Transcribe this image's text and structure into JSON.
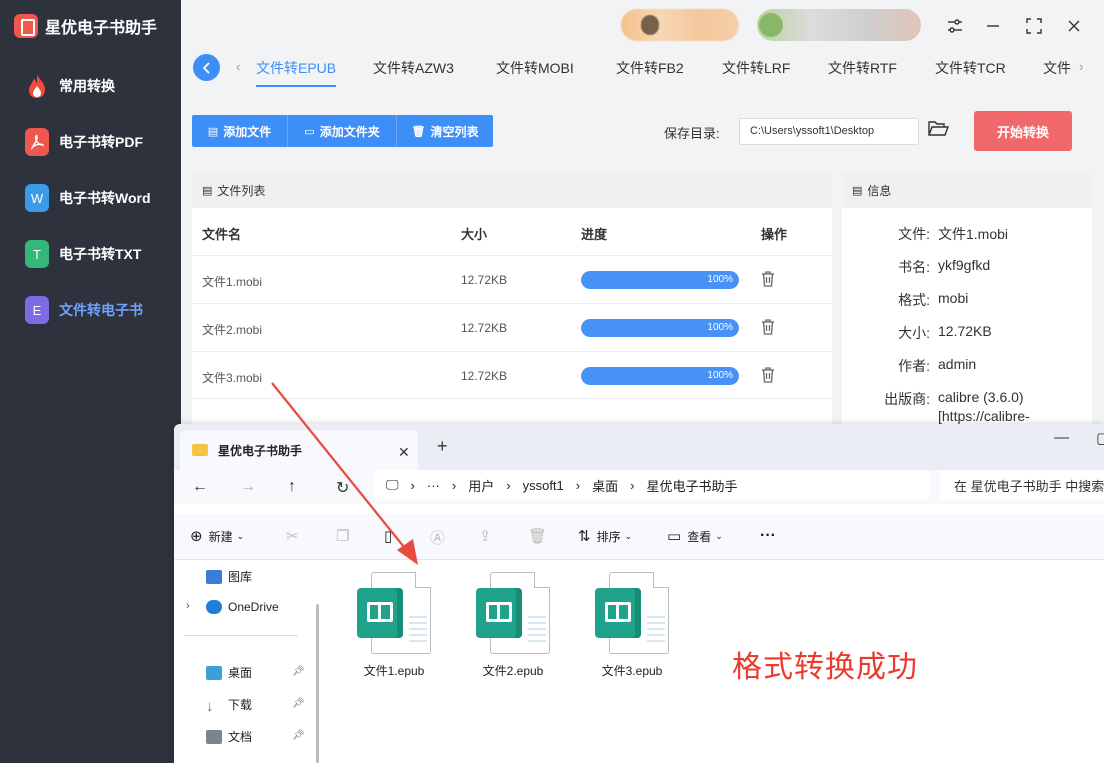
{
  "app": {
    "title": "星优电子书助手",
    "window_controls": [
      "settings-icon",
      "minimize-icon",
      "maximize-icon",
      "close-icon"
    ]
  },
  "sidebar": {
    "items": [
      {
        "label": "常用转换",
        "icon": "fire-icon",
        "color": "#f15a3a",
        "active": false
      },
      {
        "label": "电子书转PDF",
        "icon": "pdf-icon",
        "color": "#f0574f",
        "active": false
      },
      {
        "label": "电子书转Word",
        "icon": "word-icon",
        "glyph": "W",
        "color": "#3a9be9",
        "active": false
      },
      {
        "label": "电子书转TXT",
        "icon": "txt-icon",
        "glyph": "T",
        "color": "#35b77a",
        "active": false
      },
      {
        "label": "文件转电子书",
        "icon": "ebook-icon",
        "glyph": "E",
        "color": "#7d6be6",
        "active": true
      }
    ]
  },
  "tabs": {
    "items": [
      "文件转EPUB",
      "文件转AZW3",
      "文件转MOBI",
      "文件转FB2",
      "文件转LRF",
      "文件转RTF",
      "文件转TCR",
      "文件"
    ],
    "active_index": 0
  },
  "toolbar": {
    "add_file": "添加文件",
    "add_folder": "添加文件夹",
    "clear_list": "清空列表",
    "save_label": "保存目录:",
    "save_path": "C:\\Users\\yssoft1\\Desktop",
    "start": "开始转换"
  },
  "file_list": {
    "title": "文件列表",
    "columns": [
      "文件名",
      "大小",
      "进度",
      "操作"
    ],
    "rows": [
      {
        "name": "文件1.mobi",
        "size": "12.72KB",
        "progress": 100,
        "progress_label": "100%"
      },
      {
        "name": "文件2.mobi",
        "size": "12.72KB",
        "progress": 100,
        "progress_label": "100%"
      },
      {
        "name": "文件3.mobi",
        "size": "12.72KB",
        "progress": 100,
        "progress_label": "100%"
      }
    ]
  },
  "info": {
    "title": "信息",
    "rows": [
      {
        "k": "文件:",
        "v": "文件1.mobi"
      },
      {
        "k": "书名:",
        "v": "ykf9gfkd"
      },
      {
        "k": "格式:",
        "v": "mobi"
      },
      {
        "k": "大小:",
        "v": "12.72KB"
      },
      {
        "k": "作者:",
        "v": "admin"
      },
      {
        "k": "出版商:",
        "v": "calibre (3.6.0)"
      },
      {
        "k": "",
        "v": "[https://calibre-"
      }
    ]
  },
  "explorer": {
    "tab_title": "星优电子书助手",
    "breadcrumb": [
      "用户",
      "yssoft1",
      "桌面",
      "星优电子书助手"
    ],
    "ellipsis": "···",
    "search_placeholder": "在 星优电子书助手 中搜索",
    "toolbar": {
      "new": "新建",
      "sort": "排序",
      "view": "查看",
      "more": "···"
    },
    "nav": [
      {
        "label": "图库",
        "color": "#3b7bd9"
      },
      {
        "label": "OneDrive",
        "color": "#1d7fd8"
      },
      {
        "label": "桌面",
        "color": "#3aa0d8",
        "pinned": true
      },
      {
        "label": "下载",
        "color": "#2f8f5e",
        "pinned": true
      },
      {
        "label": "文档",
        "color": "#7a8590",
        "pinned": true
      }
    ],
    "files": [
      "文件1.epub",
      "文件2.epub",
      "文件3.epub"
    ]
  },
  "annotation": {
    "success_text": "格式转换成功",
    "arrow_color": "#e84b3c"
  }
}
